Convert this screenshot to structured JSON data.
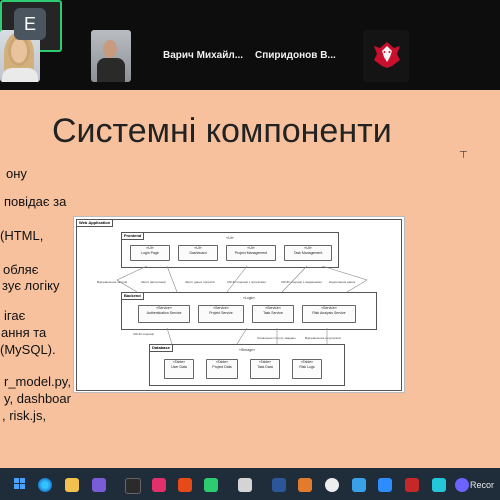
{
  "participants": [
    {
      "name": "Варич Михайл..."
    },
    {
      "name": "Спиридонов В..."
    },
    {
      "initial": "E"
    }
  ],
  "slide": {
    "title": "Системні компоненти",
    "left_bullets": [
      "ону",
      "повідає за",
      "(HTML,",
      "обляє",
      "зує логіку",
      "ігає",
      "ання та",
      "(MySQL).",
      "r_model.py,",
      "y, dashboar",
      ", risk.js,"
    ]
  },
  "diagram": {
    "outer_label": "Web Application",
    "frontend": {
      "label": "Frontend",
      "sub": "«UI»",
      "items": [
        "«UI»\nLogin Page",
        "«UI»\nDashboard",
        "«UI»\nProject Management",
        "«UI»\nTask Management"
      ]
    },
    "backend": {
      "label": "Backend",
      "sub": "«Logic»",
      "items": [
        "«Service»\nAuthentication Service",
        "«Service»\nProject Service",
        "«Service»\nTask Service",
        "«Service»\nRisk Analysis Service"
      ]
    },
    "database": {
      "label": "Database",
      "sub": "«Storage»",
      "items": [
        "«Table»\nUser Data",
        "«Table»\nProject Data",
        "«Table»\nTask Data",
        "«Table»\nRisk Logs"
      ]
    },
    "edge_labels": [
      "Відправлення запитів",
      "Запит авторизації",
      "Запит даних проектів",
      "CRUD операції з проектами",
      "CRUD операції з завданнями",
      "Надсилання даних",
      "Відображення даних",
      "CRUD операції",
      "Зчитування даних",
      "Оновлення статусу завдань",
      "Відправлення результатів"
    ]
  },
  "taskbar": {
    "recording_label": "Recor"
  }
}
